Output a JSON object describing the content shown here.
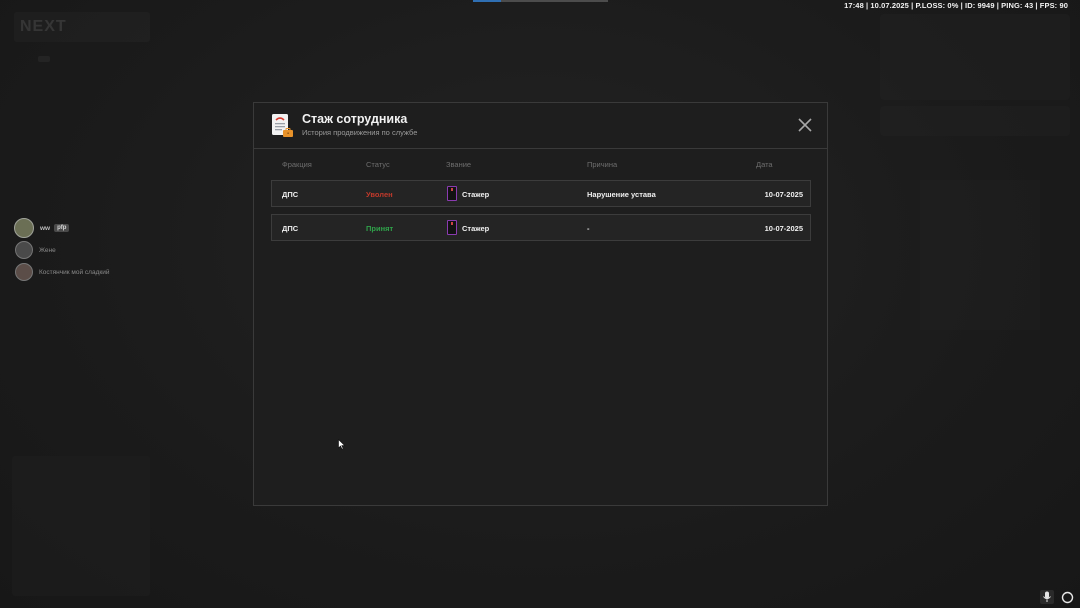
{
  "hud": {
    "stats": "17:48 | 10.07.2025 | P.LOSS: 0% | ID: 9949 | PING: 43 | FPS: 90",
    "server_logo": "NEXT"
  },
  "players": [
    {
      "name": "ww",
      "tag": "pfp"
    },
    {
      "name": "Жене",
      "tag": ""
    },
    {
      "name": "Костянчик мой сладкий",
      "tag": ""
    }
  ],
  "modal": {
    "title": "Стаж сотрудника",
    "subtitle": "История продвижения по службе",
    "columns": {
      "faction": "Фракция",
      "status": "Статус",
      "rank": "Звание",
      "reason": "Причина",
      "date": "Дата"
    },
    "rows": [
      {
        "faction": "ДПС",
        "status": "Уволен",
        "rank": "Стажер",
        "reason": "Нарушение устава",
        "date": "10-07-2025"
      },
      {
        "faction": "ДПС",
        "status": "Принят",
        "rank": "Стажер",
        "reason": "-",
        "date": "10-07-2025"
      }
    ]
  },
  "colors": {
    "status_fired": "#c0392b",
    "status_hired": "#2fa34a",
    "rank_badge_border": "#8a3bb0"
  },
  "icons": {
    "modal": "document-briefcase-icon",
    "close": "close-icon",
    "mic": "microphone-icon",
    "settings": "ring-icon"
  }
}
